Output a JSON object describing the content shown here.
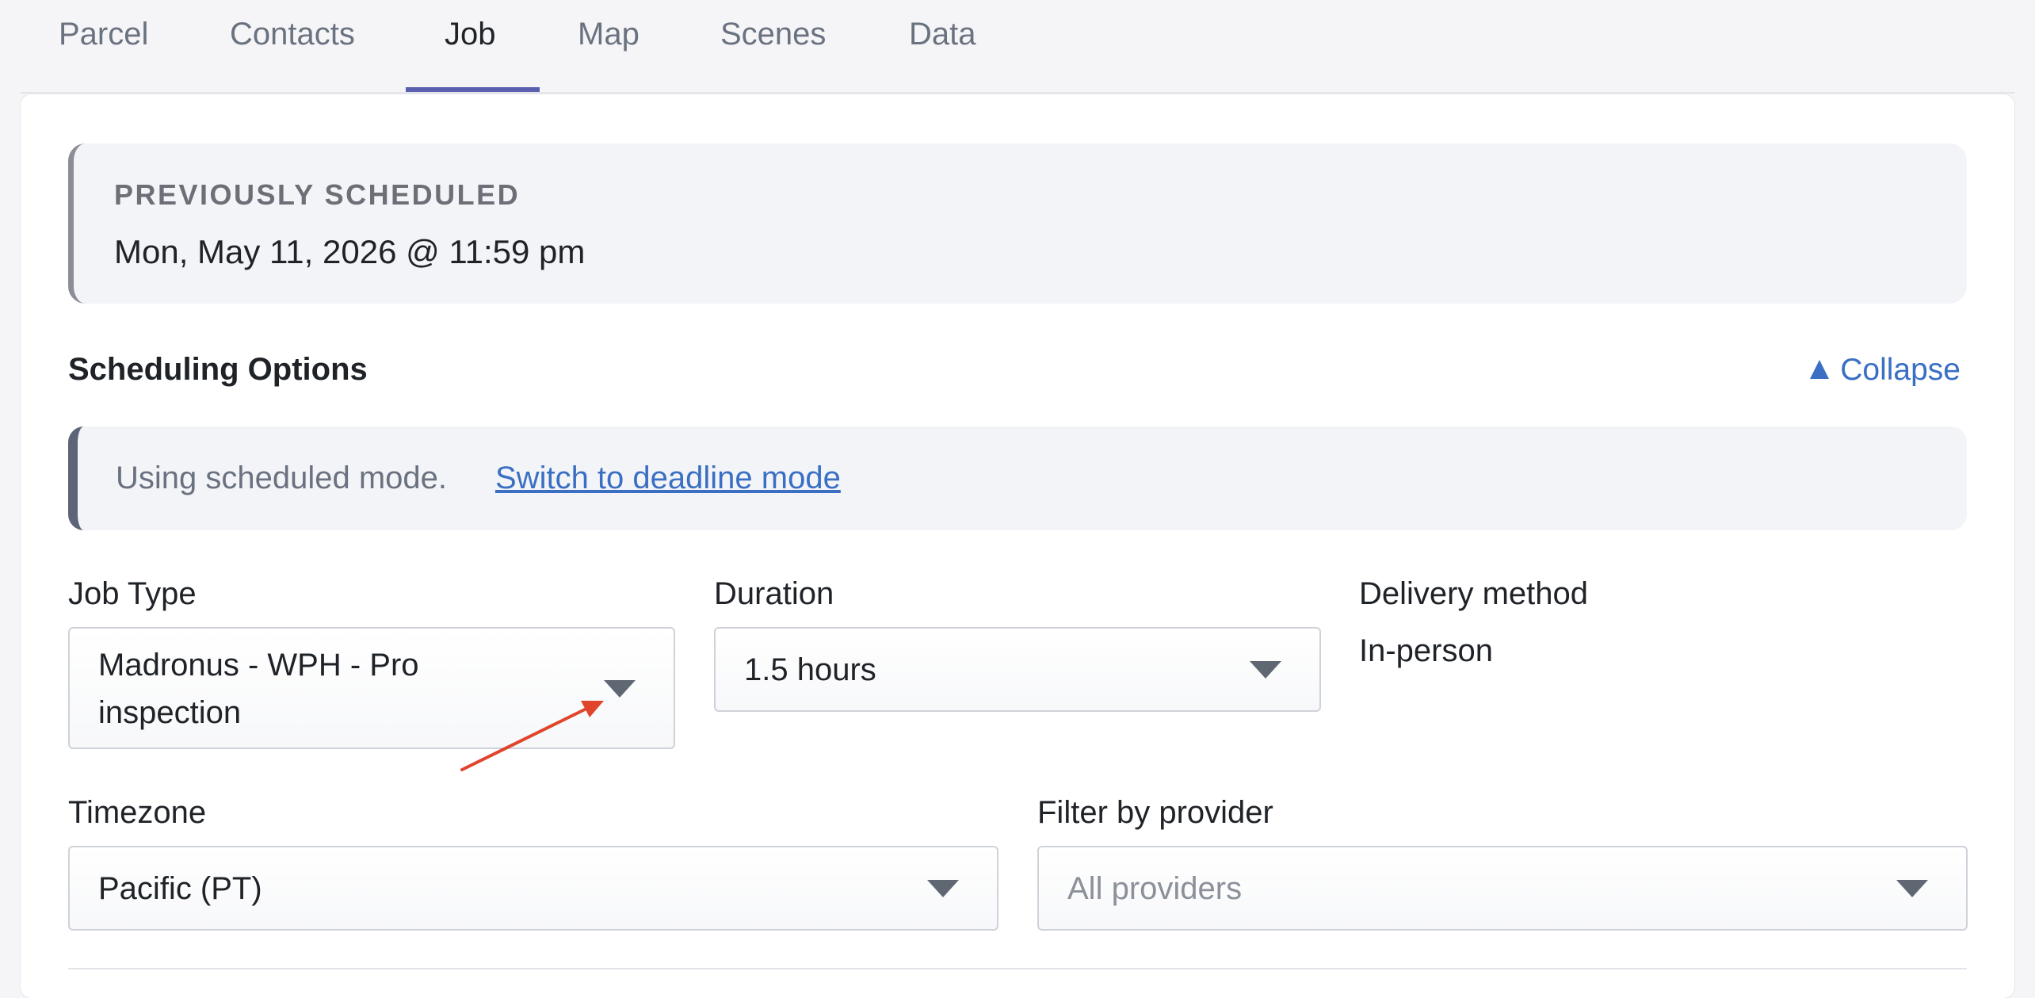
{
  "tabs": [
    {
      "label": "Parcel"
    },
    {
      "label": "Contacts"
    },
    {
      "label": "Job"
    },
    {
      "label": "Map"
    },
    {
      "label": "Scenes"
    },
    {
      "label": "Data"
    }
  ],
  "active_tab": "Job",
  "previously_scheduled": {
    "heading": "PREVIOUSLY SCHEDULED",
    "value": "Mon, May 11, 2026 @ 11:59 pm"
  },
  "scheduling": {
    "title": "Scheduling Options",
    "collapse_label": "Collapse",
    "mode_text": "Using scheduled mode.",
    "switch_link": "Switch to deadline mode"
  },
  "fields": {
    "job_type": {
      "label": "Job Type",
      "value_line1": "Madronus - WPH - Pro",
      "value_line2": "inspection"
    },
    "duration": {
      "label": "Duration",
      "value": "1.5 hours"
    },
    "delivery": {
      "label": "Delivery method",
      "value": "In-person"
    },
    "timezone": {
      "label": "Timezone",
      "value": "Pacific (PT)"
    },
    "provider": {
      "label": "Filter by provider",
      "placeholder": "All providers"
    }
  },
  "colors": {
    "accent": "#5a5fb0",
    "link": "#3a6fc4",
    "annotation_arrow": "#e0452c"
  }
}
